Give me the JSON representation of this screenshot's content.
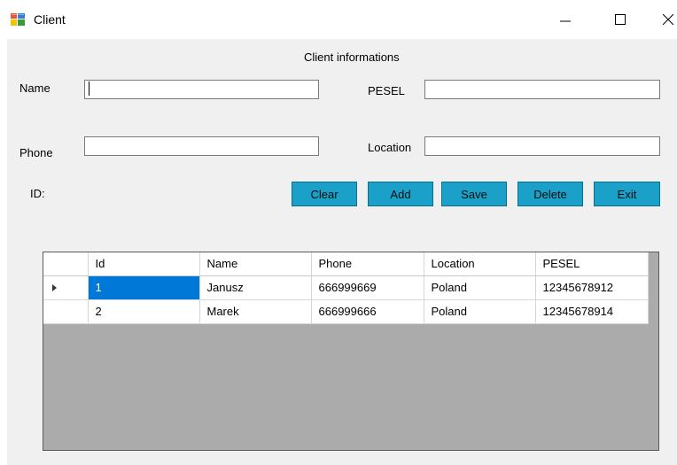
{
  "window": {
    "title": "Client",
    "icons": {
      "app": "app-window-icon",
      "minimize": "minimize-icon",
      "maximize": "maximize-icon",
      "close": "close-icon"
    }
  },
  "form": {
    "heading": "Client informations",
    "name_label": "Name",
    "name_value": "",
    "pesel_label": "PESEL",
    "pesel_value": "",
    "phone_label": "Phone",
    "phone_value": "",
    "location_label": "Location",
    "location_value": "",
    "id_label": "ID:"
  },
  "buttons": {
    "clear": "Clear",
    "add": "Add",
    "save": "Save",
    "delete": "Delete",
    "exit": "Exit",
    "color": "#1ba1c9"
  },
  "grid": {
    "columns": [
      "Id",
      "Name",
      "Phone",
      "Location",
      "PESEL"
    ],
    "rows": [
      [
        "1",
        "Janusz",
        "666999669",
        "Poland",
        "12345678912"
      ],
      [
        "2",
        "Marek",
        "666999666",
        "Poland",
        "12345678914"
      ]
    ],
    "selection_color": "#0078d7"
  }
}
